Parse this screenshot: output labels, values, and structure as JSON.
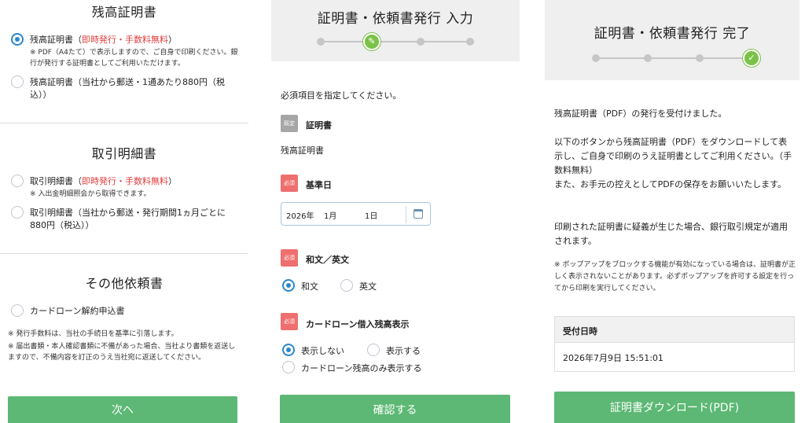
{
  "panel1": {
    "balance_section_title": "残高証明書",
    "balance_opt1_main": "残高証明書（",
    "balance_opt1_highlight": "即時発行・手数料無料",
    "balance_opt1_end": "）",
    "balance_opt1_note": "※ PDF（A4たて）で表示しますので、ご自身で印刷ください。銀行が発行する証明書としてご利用いただけます。",
    "balance_opt2": "残高証明書（当社から郵送・1通あたり880円（税込））",
    "transaction_section_title": "取引明細書",
    "transaction_opt1_main": "取引明細書（",
    "transaction_opt1_highlight": "即時発行・手数料無料",
    "transaction_opt1_end": "）",
    "transaction_opt1_note": "※ 入出金明細照会から取得できます。",
    "transaction_opt2": "取引明細書（当社から郵送・発行期間1ヵ月ごとに880円（税込））",
    "other_section_title": "その他依頼書",
    "other_opt1": "カードローン解約申込書",
    "footnote1": "※ 発行手数料は、当社の手続日を基準に引落します。",
    "footnote2": "※ 届出書類・本人確認書類に不備があった場合、当社より書類を返送しますので、不備内容を訂正のうえ当社宛に返送してください。",
    "next_button": "次へ"
  },
  "panel2": {
    "title": "証明書・依頼書発行 入力",
    "instruction": "必須項目を指定してください。",
    "tag_fixed": "既定",
    "tag_required": "必須",
    "cert_label": "証明書",
    "cert_value": "残高証明書",
    "base_date_label": "基準日",
    "date_year": "2026年",
    "date_month": "1月",
    "date_day": "1日",
    "lang_label": "和文／英文",
    "lang_japanese": "和文",
    "lang_english": "英文",
    "loan_label": "カードローン借入残高表示",
    "loan_hide": "表示しない",
    "loan_show": "表示する",
    "loan_only": "カードローン残高のみ表示する",
    "confirm_button": "確認する"
  },
  "panel3": {
    "title": "証明書・依頼書発行 完了",
    "received": "残高証明書（PDF）の発行を受付けました。",
    "download_info": "以下のボタンから残高証明書（PDF）をダウンロードして表示し、ご自身で印刷のうえ証明書としてご利用ください。（手数料無料）",
    "save_info": "また、お手元の控えとしてPDFの保存をお願いいたします。",
    "doubt_info": "印刷された証明書に疑義が生じた場合、銀行取引規定が適用されます。",
    "popup_note": "※ ポップアップをブロックする機能が有効になっている場合は、証明書が正しく表示されないことがあります。必ずポップアップを許可する設定を行ってから印刷を実行してください。",
    "receipt_header": "受付日時",
    "receipt_value": "2026年7月9日 15:51:01",
    "download_button": "証明書ダウンロード(PDF)"
  },
  "colors": {
    "accent_green": "#5cb874",
    "step_green": "#7cc24a",
    "radio_blue": "#2b87c9",
    "highlight_red": "#e03d3d",
    "required_tag_red": "#ef6f6f"
  }
}
